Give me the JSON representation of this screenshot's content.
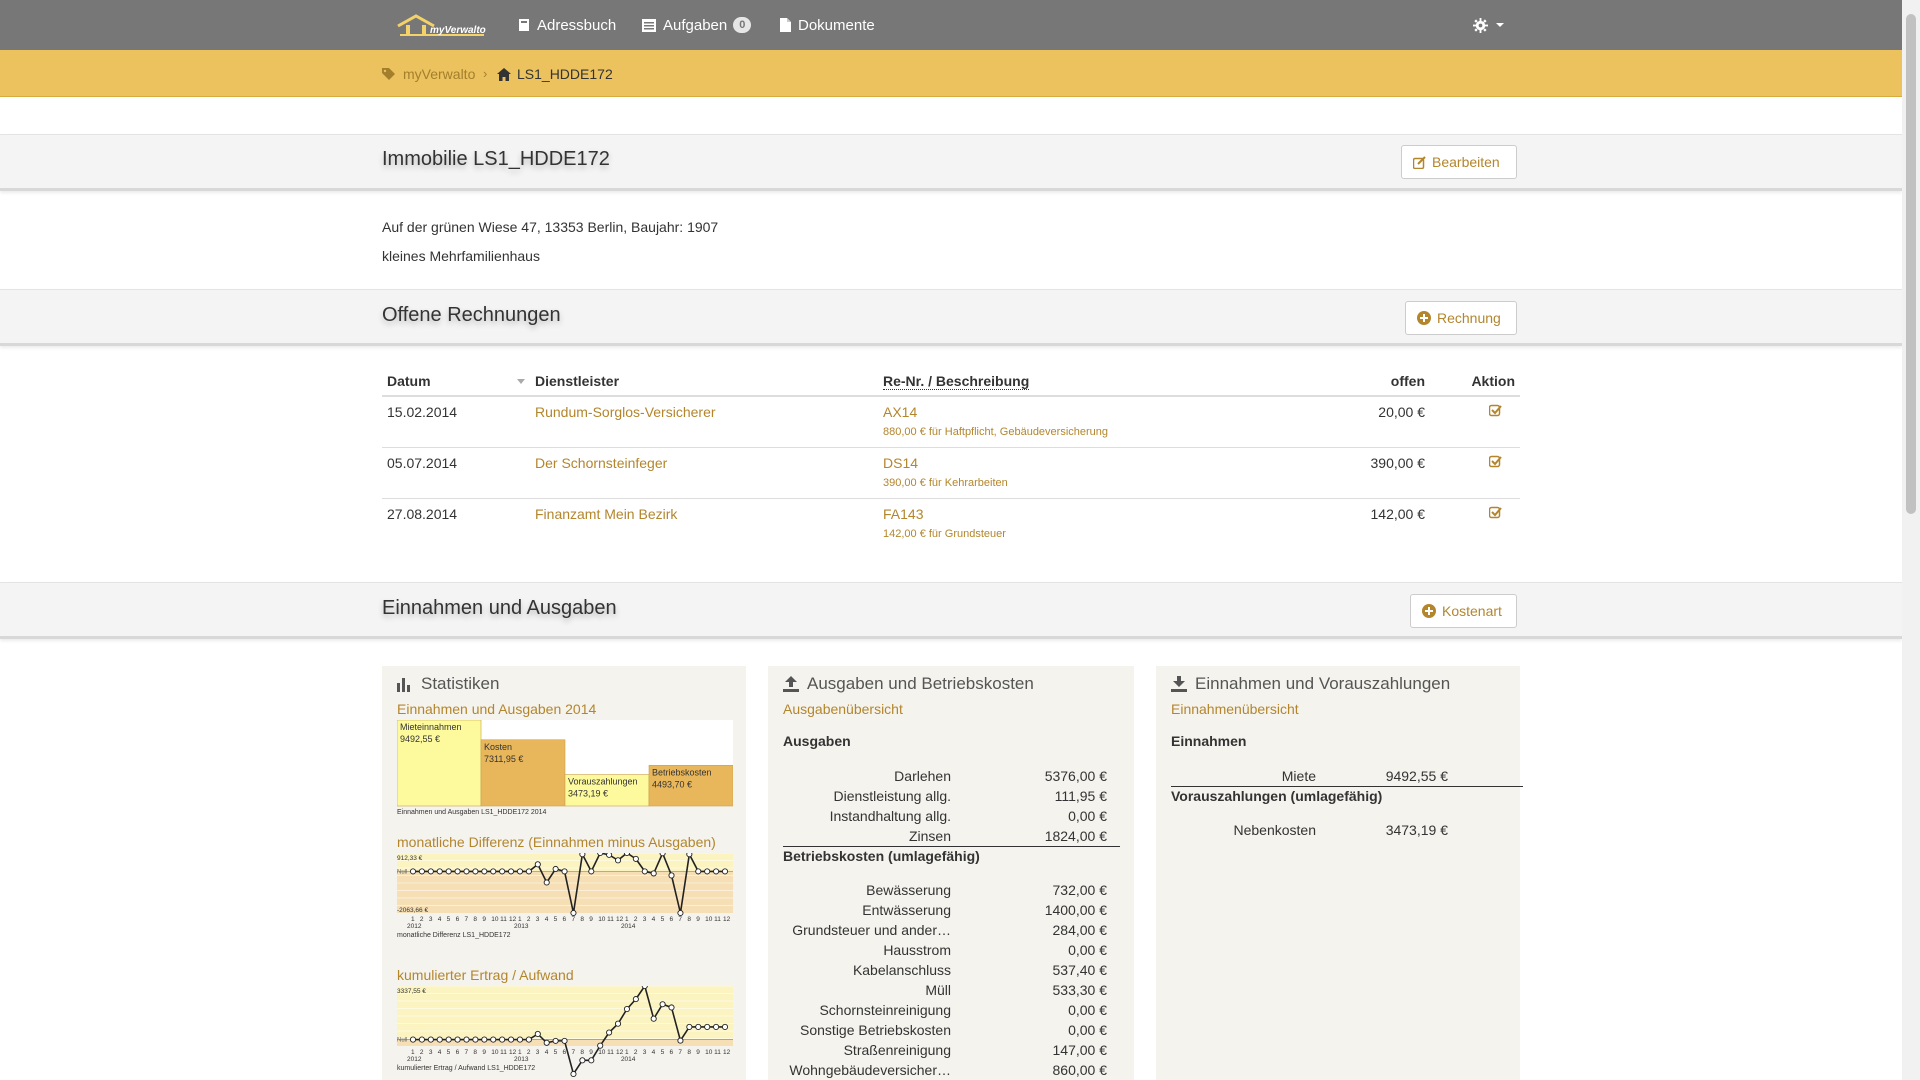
{
  "nav": {
    "brand": "myVerwalto",
    "addressbook": "Adressbuch",
    "tasks": "Aufgaben",
    "tasks_count": "0",
    "documents": "Dokumente"
  },
  "breadcrumb": {
    "root": "myVerwalto",
    "current": "LS1_HDDE172"
  },
  "property": {
    "title": "Immobilie LS1_HDDE172",
    "edit_label": "Bearbeiten",
    "address": "Auf der grünen Wiese 47, 13353 Berlin, Baujahr: 1907",
    "type": "kleines Mehrfamilienhaus"
  },
  "invoices": {
    "title": "Offene Rechnungen",
    "add_label": "Rechnung",
    "headers": [
      "Datum",
      "Dienstleister",
      "Re-Nr. / Beschreibung",
      "offen",
      "Aktion"
    ],
    "rows": [
      {
        "date": "15.02.2014",
        "provider": "Rundum-Sorglos-Versicherer",
        "number": "AX14",
        "desc": "880,00 € für Haftpflicht, Gebäudeversicherung",
        "open": "20,00 €"
      },
      {
        "date": "05.07.2014",
        "provider": "Der Schornsteinfeger",
        "number": "DS14",
        "desc": "390,00 € für Kehrarbeiten",
        "open": "390,00 €"
      },
      {
        "date": "27.08.2014",
        "provider": "Finanzamt Mein Bezirk",
        "number": "FA143",
        "desc": "142,00 € für Grundsteuer",
        "open": "142,00 €"
      }
    ]
  },
  "income": {
    "title": "Einnahmen und Ausgaben",
    "add_label": "Kostenart"
  },
  "stats": {
    "title": "Statistiken",
    "chart1_title": "Einnahmen und Ausgaben 2014",
    "chart1_caption": "Einnahmen und Ausgaben LS1_HDDE172 2014",
    "chart2_title": "monatliche Differenz (Einnahmen minus Ausgaben)",
    "chart2_caption": "monatliche Differenz LS1_HDDE172",
    "chart2_max": "912,33 €",
    "chart2_min": "-2063,66 €",
    "chart2_zero": "Null",
    "chart3_title": "kumulierter Ertrag / Aufwand",
    "chart3_caption": "kumulierter Ertrag / Aufwand LS1_HDDE172",
    "chart3_max": "3337,55 €",
    "chart3_zero": "Null",
    "years": [
      "2012",
      "2013",
      "2014"
    ]
  },
  "chart_data": [
    {
      "type": "bar",
      "title": "Einnahmen und Ausgaben 2014",
      "categories": [
        "Mieteinnahmen",
        "Kosten",
        "Vorauszahlungen",
        "Betriebskosten"
      ],
      "values": [
        9492.55,
        7311.95,
        3473.19,
        4493.7
      ],
      "value_labels": [
        "9492,55 €",
        "7311,95 €",
        "3473,19 €",
        "4493,70 €"
      ]
    },
    {
      "type": "line",
      "title": "monatliche Differenz (Einnahmen minus Ausgaben)",
      "x": [
        1,
        2,
        3,
        4,
        5,
        6,
        7,
        8,
        9,
        10,
        11,
        12,
        13,
        14,
        15,
        16,
        17,
        18,
        19,
        20,
        21,
        22,
        23,
        24,
        25,
        26,
        27,
        28,
        29,
        30,
        31,
        32,
        33,
        34,
        35,
        36
      ],
      "values": [
        0,
        0,
        0,
        0,
        0,
        0,
        0,
        0,
        0,
        0,
        0,
        0,
        0,
        0,
        350,
        -550,
        120,
        0,
        -2063.66,
        850,
        0,
        912.33,
        820,
        550,
        912.33,
        620,
        0,
        -100,
        900,
        -200,
        -2063.66,
        850,
        0,
        0,
        0,
        0
      ],
      "ylim": [
        -2063.66,
        912.33
      ]
    },
    {
      "type": "line",
      "title": "kumulierter Ertrag / Aufwand",
      "x": [
        1,
        2,
        3,
        4,
        5,
        6,
        7,
        8,
        9,
        10,
        11,
        12,
        13,
        14,
        15,
        16,
        17,
        18,
        19,
        20,
        21,
        22,
        23,
        24,
        25,
        26,
        27,
        28,
        29,
        30,
        31,
        32,
        33,
        34,
        35,
        36
      ],
      "values": [
        0,
        0,
        0,
        0,
        0,
        0,
        0,
        0,
        0,
        0,
        0,
        0,
        0,
        0,
        350,
        -200,
        -80,
        -80,
        -2143,
        -1293,
        -1293,
        -381,
        439,
        989,
        1901,
        2521,
        3337.55,
        1300,
        2200,
        2000,
        -63,
        787,
        787,
        787,
        787,
        787
      ],
      "ylim": [
        -400,
        3337.55
      ]
    }
  ],
  "expenses": {
    "title": "Ausgaben und Betriebskosten",
    "link": "Ausgabenübersicht",
    "head1": "Ausgaben",
    "items1": [
      {
        "label": "Darlehen",
        "value": "5376,00 €"
      },
      {
        "label": "Dienstleistung allg.",
        "value": "111,95 €"
      },
      {
        "label": "Instandhaltung allg.",
        "value": "0,00 €"
      },
      {
        "label": "Zinsen",
        "value": "1824,00 €"
      }
    ],
    "head2": "Betriebskosten (umlagefähig)",
    "items2": [
      {
        "label": "Bewässerung",
        "value": "732,00 €"
      },
      {
        "label": "Entwässerung",
        "value": "1400,00 €"
      },
      {
        "label": "Grundsteuer und ander…",
        "value": "284,00 €"
      },
      {
        "label": "Hausstrom",
        "value": "0,00 €"
      },
      {
        "label": "Kabelanschluss",
        "value": "537,40 €"
      },
      {
        "label": "Müll",
        "value": "533,30 €"
      },
      {
        "label": "Schornsteinreinigung",
        "value": "0,00 €"
      },
      {
        "label": "Sonstige Betriebskosten",
        "value": "0,00 €"
      },
      {
        "label": "Straßenreinigung",
        "value": "147,00 €"
      },
      {
        "label": "Wohngebäudeversicher…",
        "value": "860,00 €"
      }
    ]
  },
  "revenues": {
    "title": "Einnahmen und Vorauszahlungen",
    "link": "Einnahmenübersicht",
    "head1": "Einnahmen",
    "items1": [
      {
        "label": "Miete",
        "value": "9492,55 €"
      }
    ],
    "head2": "Vorauszahlungen (umlagefähig)",
    "items2": [
      {
        "label": "Nebenkosten",
        "value": "3473,19 €"
      }
    ]
  },
  "colors": {
    "nav_bg": "#777777",
    "accent": "#ecc25f",
    "link": "#b3862d",
    "bar_light": "#fdfa9e",
    "bar_dark": "#e9b75b",
    "chart_bg": "#fbf4c0"
  }
}
